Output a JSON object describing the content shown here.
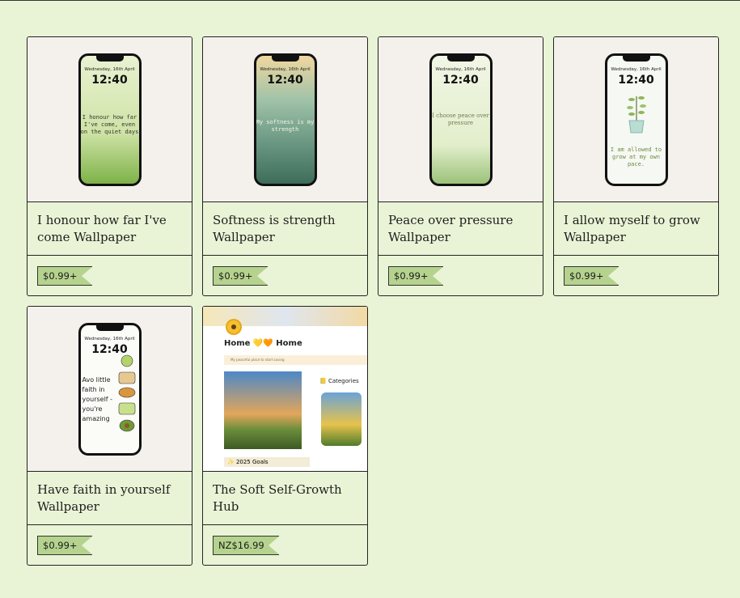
{
  "products": [
    {
      "title": "I honour how far I've come Wallpaper",
      "price": "$0.99+",
      "preview": {
        "date": "Wednesday, 16th April",
        "time": "12:40",
        "quote": "I honour how far I've come, even on the quiet days",
        "bg_top": "#e9f2d2",
        "bg_bottom": "#7eb249"
      }
    },
    {
      "title": "Softness is strength Wallpaper",
      "price": "$0.99+",
      "preview": {
        "date": "Wednesday, 16th April",
        "time": "12:40",
        "quote": "My softness is my strength",
        "bg_top": "#f0d7a0",
        "bg_bottom": "#3d6d5a"
      }
    },
    {
      "title": "Peace over pressure Wallpaper",
      "price": "$0.99+",
      "preview": {
        "date": "Wednesday, 16th April",
        "time": "12:40",
        "quote": "I choose peace over pressure",
        "bg_top": "#f2f6e6",
        "bg_bottom": "#cde3a9"
      }
    },
    {
      "title": "I allow myself to grow Wallpaper",
      "price": "$0.99+",
      "preview": {
        "date": "Wednesday, 16th April",
        "time": "12:40",
        "quote": "I am allowed to grow at my own pace.",
        "bg_top": "#f6f8f3",
        "bg_bottom": "#eef2e8"
      }
    },
    {
      "title": "Have faith in yourself Wallpaper",
      "price": "$0.99+",
      "preview": {
        "date": "Wednesday, 16th April",
        "time": "12:40",
        "quote": "Avo little faith in yourself - you're amazing",
        "bg_top": "#fbfbf8",
        "bg_bottom": "#f3f3ee"
      }
    },
    {
      "title": "The Soft Self-Growth Hub",
      "price": "NZ$16.99",
      "preview": {
        "hub_title": "Home 💛🧡 Home",
        "hub_note": "My peaceful place to start saving",
        "hub_categories": "📒 Categories",
        "hub_goals": "✨ 2025 Goals"
      }
    }
  ],
  "colors": {
    "background": "#e9f4d6",
    "price_tag": "#b5d38e",
    "border": "#222222"
  }
}
